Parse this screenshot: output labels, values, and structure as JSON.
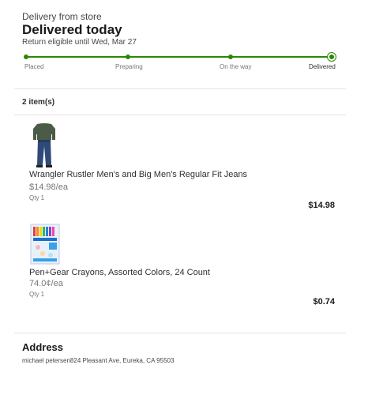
{
  "delivery": {
    "source_label": "Delivery from store",
    "status_title": "Delivered today",
    "return_note": "Return eligible until Wed, Mar 27"
  },
  "tracker": {
    "steps": [
      "Placed",
      "Preparing",
      "On the way",
      "Delivered"
    ],
    "current_step": 3,
    "color": "#2a8703"
  },
  "items": {
    "count_label": "2 item(s)",
    "list": [
      {
        "name": "Wrangler Rustler Men's and Big Men's Regular Fit Jeans",
        "unit_price": "$14.98/ea",
        "qty": "Qty 1",
        "total": "$14.98"
      },
      {
        "name": "Pen+Gear Crayons, Assorted Colors, 24 Count",
        "unit_price": "74.0¢/ea",
        "qty": "Qty 1",
        "total": "$0.74"
      }
    ]
  },
  "address": {
    "title": "Address",
    "text": "michael petersen824 Pleasant Ave, Eureka, CA 95503"
  }
}
